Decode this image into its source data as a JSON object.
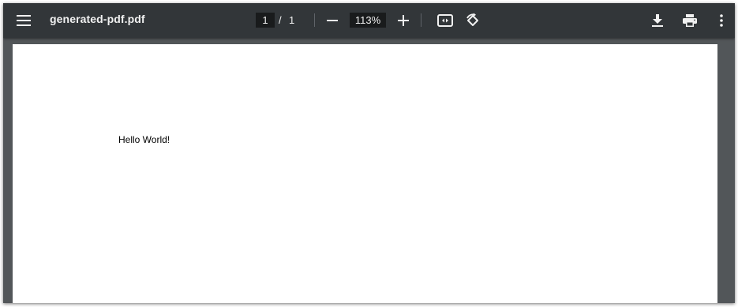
{
  "toolbar": {
    "menu_icon": "menu-icon",
    "title": "generated-pdf.pdf",
    "page_current": "1",
    "page_separator": "/",
    "page_total": "1",
    "zoom_out_icon": "minus-icon",
    "zoom_value": "113%",
    "zoom_in_icon": "plus-icon",
    "fit_icon": "fit-to-width-icon",
    "rotate_icon": "rotate-icon",
    "download_icon": "download-icon",
    "print_icon": "print-icon",
    "more_icon": "more-vert-icon"
  },
  "document": {
    "text": "Hello World!"
  },
  "colors": {
    "toolbar_bg": "#323639",
    "viewer_bg": "#525659",
    "page_bg": "#ffffff",
    "input_bg": "#191b1c"
  }
}
